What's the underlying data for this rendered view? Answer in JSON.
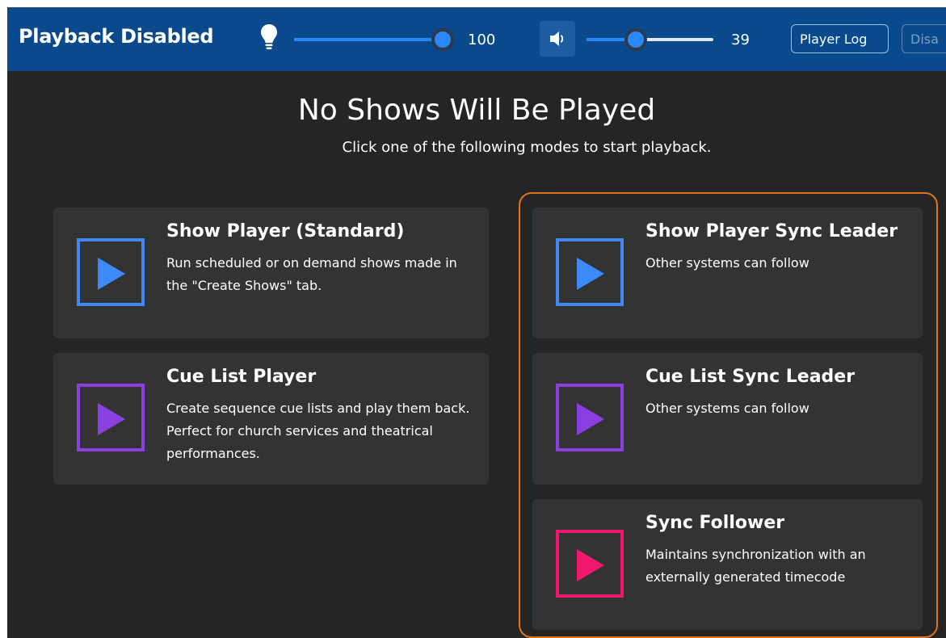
{
  "header": {
    "title": "Playback Disabled",
    "brightness": {
      "icon": "lightbulb-icon",
      "value": "100",
      "level": 1.0
    },
    "volume": {
      "icon": "speaker-icon",
      "value": "39",
      "level": 0.39
    },
    "player_log_label": "Player Log",
    "disabled_label": "Disa"
  },
  "main": {
    "heading": "No Shows Will Be Played",
    "subheading": "Click one of the following modes to start playback."
  },
  "modes": {
    "show_player": {
      "title": "Show Player (Standard)",
      "description": "Run scheduled or on demand shows made in the \"Create Shows\" tab.",
      "icon": "play-icon",
      "color": "#3d8af7"
    },
    "cue_list_player": {
      "title": "Cue List Player",
      "description": "Create sequence cue lists and play them back. Perfect for church services and theatrical performances.",
      "icon": "play-icon",
      "color": "#8b3fe0"
    },
    "show_player_sync_leader": {
      "title": "Show Player Sync Leader",
      "description": "Other systems can follow",
      "icon": "play-icon",
      "color": "#3d8af7"
    },
    "cue_list_sync_leader": {
      "title": "Cue List Sync Leader",
      "description": "Other systems can follow",
      "icon": "play-icon",
      "color": "#8b3fe0"
    },
    "sync_follower": {
      "title": "Sync Follower",
      "description": "Maintains synchronization with an externally generated timecode",
      "icon": "play-icon",
      "color": "#f0186e"
    }
  },
  "colors": {
    "header_bg": "#0a4a8c",
    "app_bg": "#252525",
    "card_bg": "#333333",
    "highlight_border": "#e0741a",
    "slider_accent": "#2a88ff"
  }
}
